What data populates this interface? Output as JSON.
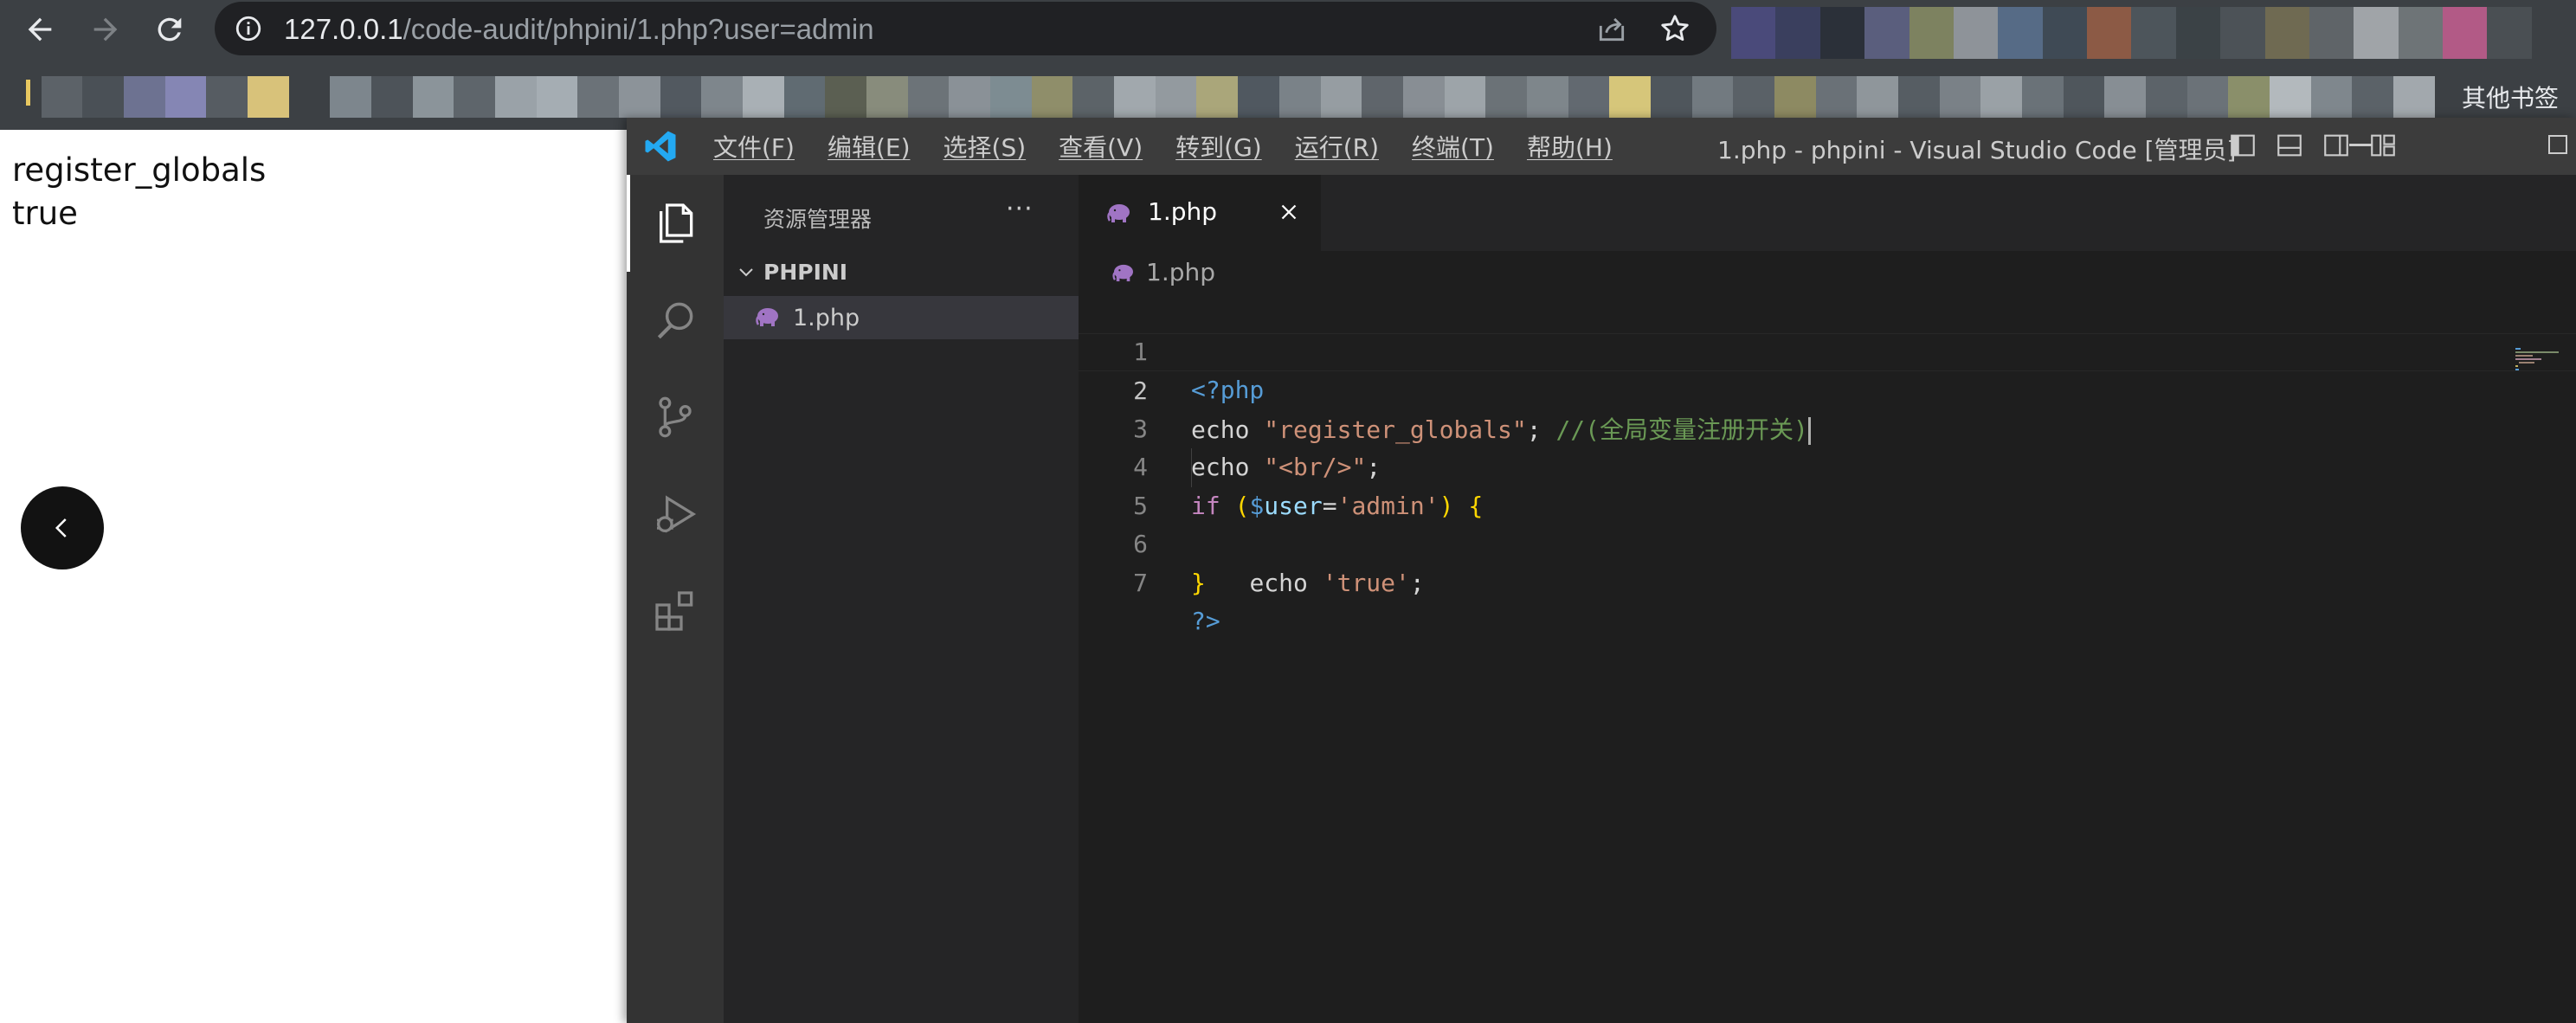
{
  "browser": {
    "url_host": "127.0.0.1",
    "url_path": "/code-audit/phpini/1.php?user=admin",
    "other_bookmarks": "其他书签"
  },
  "page": {
    "output_lines": [
      "register_globals",
      "true"
    ]
  },
  "vscode": {
    "menu": [
      "文件(F)",
      "编辑(E)",
      "选择(S)",
      "查看(V)",
      "转到(G)",
      "运行(R)",
      "终端(T)",
      "帮助(H)"
    ],
    "window_title": "1.php - phpini - Visual Studio Code [管理员]",
    "explorer_title": "资源管理器",
    "more_actions": "···",
    "folder_name": "PHPINI",
    "file_name": "1.php",
    "tab_label": "1.php",
    "breadcrumb": "1.php",
    "line_numbers": [
      "1",
      "2",
      "3",
      "4",
      "5",
      "6",
      "7"
    ],
    "code": {
      "l1_tag": "<?php",
      "l2_kw": "echo ",
      "l2_str": "\"register_globals\"",
      "l2_semi": "; ",
      "l2_cmt": "//(全局变量注册开关)",
      "l3_kw": "echo ",
      "l3_str": "\"<br/>\"",
      "l3_semi": ";",
      "l4_if": "if ",
      "l4_open": "(",
      "l4_sig": "$",
      "l4_var": "user",
      "l4_eq": "=",
      "l4_str": "'admin'",
      "l4_close": ")",
      "l4_brace": " {",
      "l5_indent": "    ",
      "l5_kw": "echo ",
      "l5_str": "'true'",
      "l5_semi": ";",
      "l6_brace": "}",
      "l7_tag": "?>"
    }
  },
  "colors": {
    "chrome_frame": "#3c4044",
    "vscode_titlebar": "#3c3c3c",
    "vscode_activitybar": "#333333",
    "vscode_sidebar": "#252526",
    "vscode_editor": "#1e1e1e",
    "php_icon": "#a074c4"
  }
}
